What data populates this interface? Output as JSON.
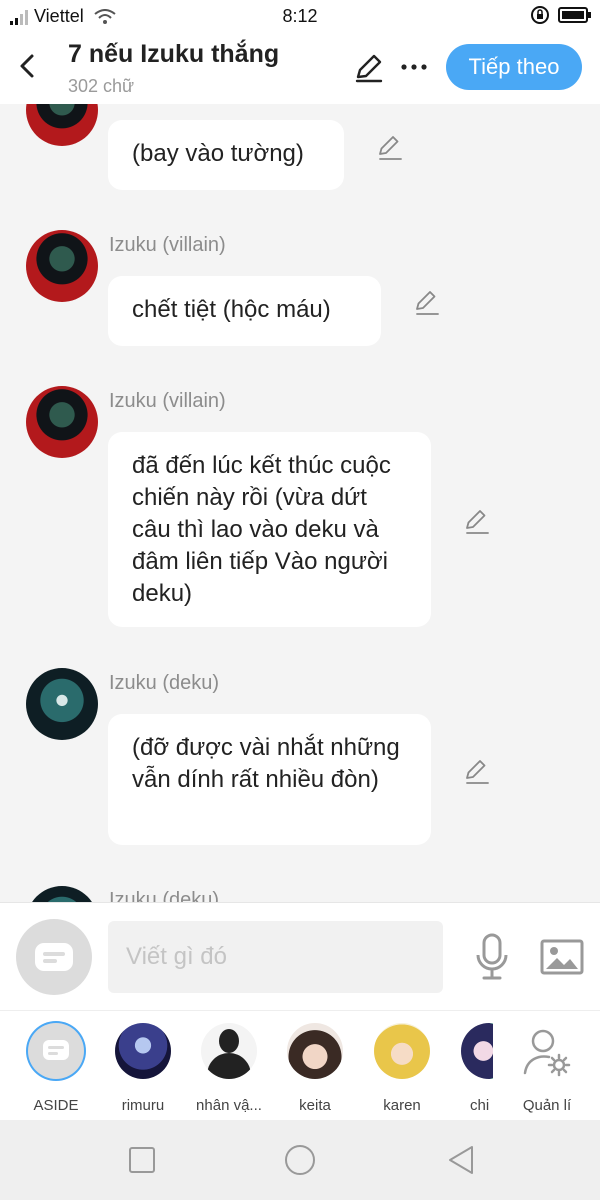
{
  "status_bar": {
    "carrier": "Viettel",
    "time": "8:12"
  },
  "header": {
    "title": "7 nếu Izuku thắng",
    "subtitle": "302 chữ",
    "next_label": "Tiếp theo"
  },
  "messages": [
    {
      "sender": "",
      "text": "(bay vào tường)",
      "avatar": "villain-avatar"
    },
    {
      "sender": "Izuku (villain)",
      "text": "chết tiệt (hộc máu)",
      "avatar": "villain-avatar"
    },
    {
      "sender": "Izuku (villain)",
      "text": "đã đến lúc kết thúc cuộc chiến này rồi (vừa dứt câu thì lao vào deku và đâm liên tiếp Vào người deku)",
      "avatar": "villain-avatar"
    },
    {
      "sender": "Izuku (deku)",
      "text": "(đỡ được vài nhắt những vẫn dính rất nhiều đòn)",
      "avatar": "deku-avatar"
    },
    {
      "sender": "Izuku (deku)",
      "text": "",
      "avatar": "deku-avatar"
    }
  ],
  "composer": {
    "placeholder": "Viết gì đó"
  },
  "characters": [
    {
      "name": "ASIDE"
    },
    {
      "name": "rimuru"
    },
    {
      "name": "nhân vậ..."
    },
    {
      "name": "keita"
    },
    {
      "name": "karen"
    },
    {
      "name": "chi"
    },
    {
      "name": "Quản lí"
    }
  ],
  "colors": {
    "accent": "#4aa8f5",
    "background": "#f4f4f4",
    "bubble": "#ffffff",
    "sender_text": "#8c8c8c"
  }
}
